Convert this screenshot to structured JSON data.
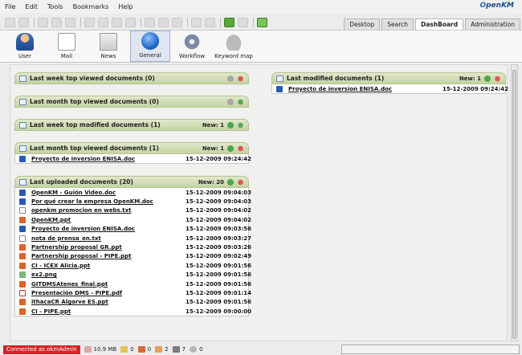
{
  "menu": [
    "File",
    "Edit",
    "Tools",
    "Bookmarks",
    "Help"
  ],
  "logo": {
    "prefix": "O",
    "rest": "penKM"
  },
  "tabs": [
    {
      "label": "Desktop",
      "active": false
    },
    {
      "label": "Search",
      "active": false
    },
    {
      "label": "DashBoard",
      "active": true
    },
    {
      "label": "Administration",
      "active": false
    }
  ],
  "iconbar": [
    {
      "label": "User",
      "icon": "user-icon"
    },
    {
      "label": "Mail",
      "icon": "mail-icon"
    },
    {
      "label": "News",
      "icon": "news-icon"
    },
    {
      "label": "General",
      "icon": "globe-icon",
      "selected": true
    },
    {
      "label": "Workflow",
      "icon": "gear-icon"
    },
    {
      "label": "Keyword map",
      "icon": "cloud-icon"
    }
  ],
  "widgets": {
    "last_week_viewed": {
      "title": "Last week top viewed documents  (0)"
    },
    "last_month_viewed_empty": {
      "title": "Last month top viewed documents  (0)"
    },
    "last_week_modified": {
      "title": "Last week top modified documents  (1)",
      "new": "New: 1"
    },
    "last_month_viewed": {
      "title": "Last month top viewed documents  (1)",
      "new": "New: 1",
      "rows": [
        {
          "name": "Proyecto de inversion ENISA.doc",
          "date": "15-12-2009 09:24:42",
          "type": "doc"
        }
      ]
    },
    "last_uploaded": {
      "title": "Last uploaded documents  (20)",
      "new": "New: 20",
      "rows": [
        {
          "name": "OpenKM - Guión Video.doc",
          "date": "15-12-2009 09:04:03",
          "type": "doc"
        },
        {
          "name": "Por qué crear la empresa OpenKM.doc",
          "date": "15-12-2009 09:04:03",
          "type": "doc"
        },
        {
          "name": "openkm promocion en webs.txt",
          "date": "15-12-2009 09:04:02",
          "type": "txt"
        },
        {
          "name": "OpenKM.ppt",
          "date": "15-12-2009 09:04:02",
          "type": "ppt"
        },
        {
          "name": "Proyecto de inversion ENISA.doc",
          "date": "15-12-2009 09:03:56",
          "type": "doc"
        },
        {
          "name": "nota de prensa_en.txt",
          "date": "15-12-2009 09:03:27",
          "type": "txt"
        },
        {
          "name": "Partnership proposal GR.ppt",
          "date": "15-12-2009 09:03:26",
          "type": "ppt"
        },
        {
          "name": "Partnership proposal - PIPE.ppt",
          "date": "15-12-2009 09:02:49",
          "type": "ppt"
        },
        {
          "name": "CI - ICEX Alicia.ppt",
          "date": "15-12-2009 09:01:56",
          "type": "ppt"
        },
        {
          "name": "ex2.png",
          "date": "15-12-2009 09:01:56",
          "type": "png"
        },
        {
          "name": "GITDMSAtenes_final.ppt",
          "date": "15-12-2009 09:01:56",
          "type": "ppt"
        },
        {
          "name": "Presentación DMS - PIPE.pdf",
          "date": "15-12-2009 09:01:14",
          "type": "pdf"
        },
        {
          "name": "ithacaCR Algarve ES.ppt",
          "date": "15-12-2009 09:01:56",
          "type": "ppt"
        },
        {
          "name": "CI - PIPE.ppt",
          "date": "15-12-2009 09:00:00",
          "type": "ppt"
        }
      ]
    },
    "last_modified": {
      "title": "Last modified documents  (1)",
      "new": "New: 1",
      "rows": [
        {
          "name": "Proyecto de inversion ENISA.doc",
          "date": "15-12-2009 09:24:42",
          "type": "doc"
        }
      ]
    }
  },
  "status": {
    "connected": "Connected as okmAdmin",
    "size": "10.9 MB",
    "c1": "0",
    "c2": "0",
    "c3": "2",
    "c4": "7",
    "c5": "0"
  }
}
